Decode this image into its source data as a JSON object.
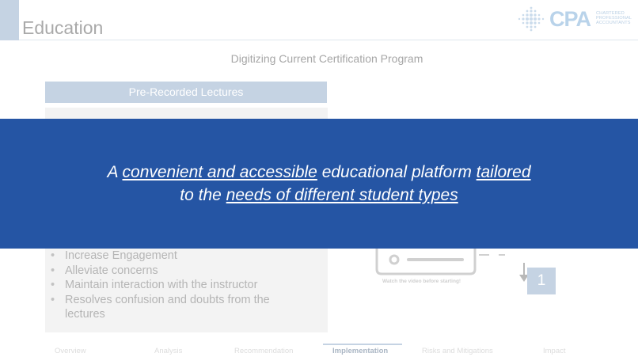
{
  "slide": {
    "title": "Education",
    "subtitle": "Digitizing Current Certification Program"
  },
  "logo": {
    "wordmark": "CPA",
    "lines": [
      "CHARTERED",
      "PROFESSIONAL",
      "ACCOUNTANTS"
    ]
  },
  "left_panel": {
    "header": "Pre-Recorded Lectures",
    "benefits": [
      "Increase Engagement",
      "Alleviate concerns",
      "Maintain interaction with the instructor",
      "Resolves confusion and doubts from the lectures"
    ]
  },
  "right_panel": {
    "caption": "Watch the video before starting!",
    "step": "1"
  },
  "banner": {
    "line1": {
      "pre": "A ",
      "u1": "convenient and accessible",
      "mid": " educational platform ",
      "u2": "tailored"
    },
    "line2": {
      "pre": "to the ",
      "u1": "needs of different student types"
    }
  },
  "nav": {
    "items": [
      "Overview",
      "Analysis",
      "Recommendation",
      "Implementation",
      "Risks and Mitigations",
      "Impact"
    ],
    "active": "Implementation"
  },
  "colors": {
    "banner": "#2555a4",
    "accent": "#c5d3e3",
    "panel": "#f3f3f3"
  }
}
